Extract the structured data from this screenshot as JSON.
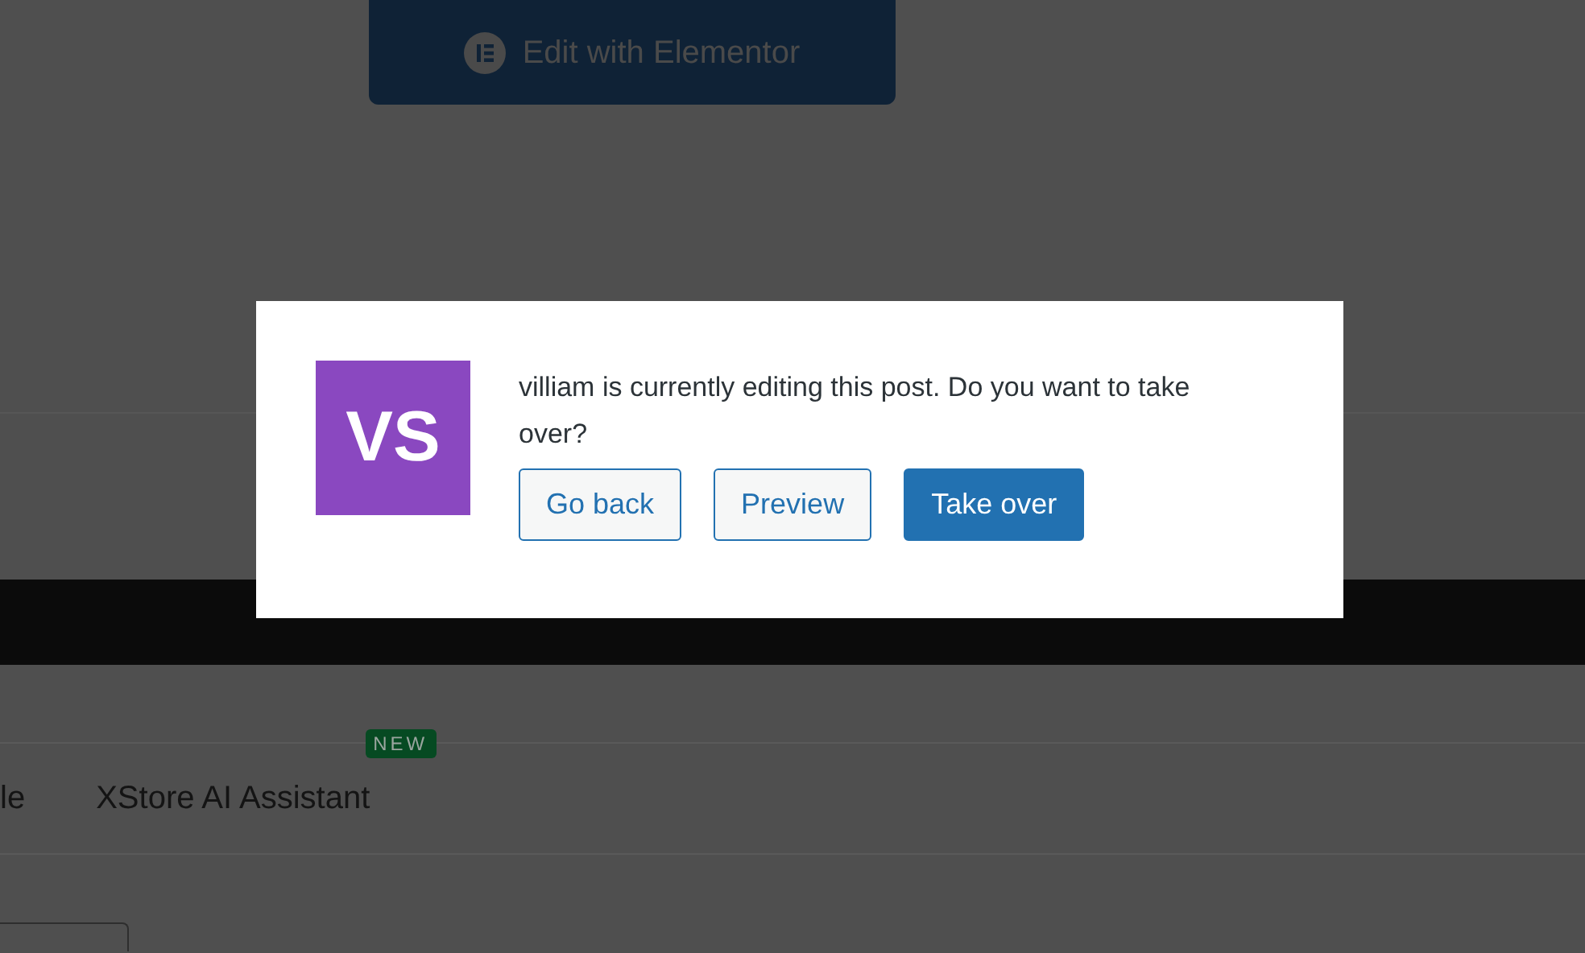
{
  "editor_button": {
    "label": "Edit with Elementor"
  },
  "tabs": [
    {
      "label": "le",
      "selected": false
    },
    {
      "label": "XStore AI Assistant",
      "selected": false,
      "badge": "NEW"
    }
  ],
  "dialog": {
    "avatar": "VS",
    "message": "villiam is currently editing this post. Do you want to take over?",
    "buttons": [
      {
        "label": "Go back",
        "kind": "secondary"
      },
      {
        "label": "Preview",
        "kind": "secondary"
      },
      {
        "label": "Take over",
        "kind": "primary"
      }
    ]
  }
}
